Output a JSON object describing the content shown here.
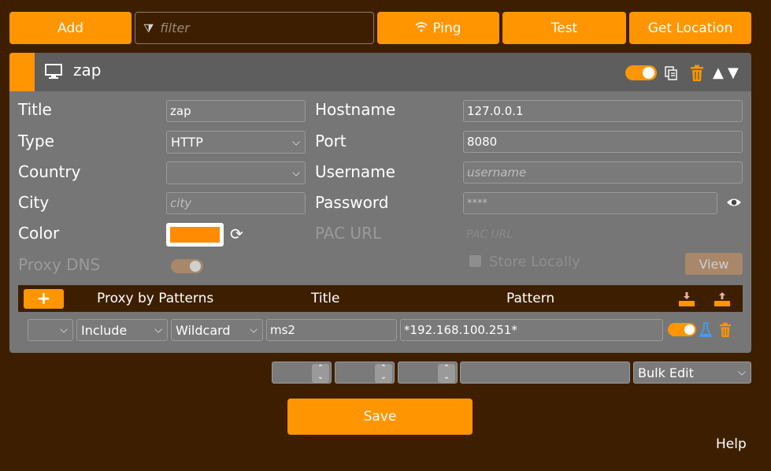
{
  "toolbar": {
    "add_label": "Add",
    "filter_placeholder": "filter",
    "ping_label": "Ping",
    "test_label": "Test",
    "get_location_label": "Get Location"
  },
  "proxy": {
    "name": "zap",
    "accent_color": "#ff9500"
  },
  "form": {
    "title_label": "Title",
    "title_value": "zap",
    "type_label": "Type",
    "type_value": "HTTP",
    "country_label": "Country",
    "country_value": "",
    "city_label": "City",
    "city_placeholder": "city",
    "color_label": "Color",
    "color_value": "#ff8c00",
    "proxy_dns_label": "Proxy DNS",
    "hostname_label": "Hostname",
    "hostname_value": "127.0.0.1",
    "port_label": "Port",
    "port_value": "8080",
    "username_label": "Username",
    "username_placeholder": "username",
    "password_label": "Password",
    "password_value": "****",
    "pac_url_label": "PAC URL",
    "pac_url_placeholder": "PAC URL",
    "store_locally_label": "Store Locally",
    "view_label": "View"
  },
  "patterns": {
    "header_add": "+",
    "col_proxy_by_patterns": "Proxy by Patterns",
    "col_title": "Title",
    "col_pattern": "Pattern",
    "rows": [
      {
        "select0": "",
        "type": "Include",
        "match": "Wildcard",
        "title": "ms2",
        "pattern": "*192.168.100.251*"
      }
    ]
  },
  "bottom": {
    "bulk_edit": "Bulk Edit",
    "save_label": "Save",
    "help_label": "Help"
  }
}
